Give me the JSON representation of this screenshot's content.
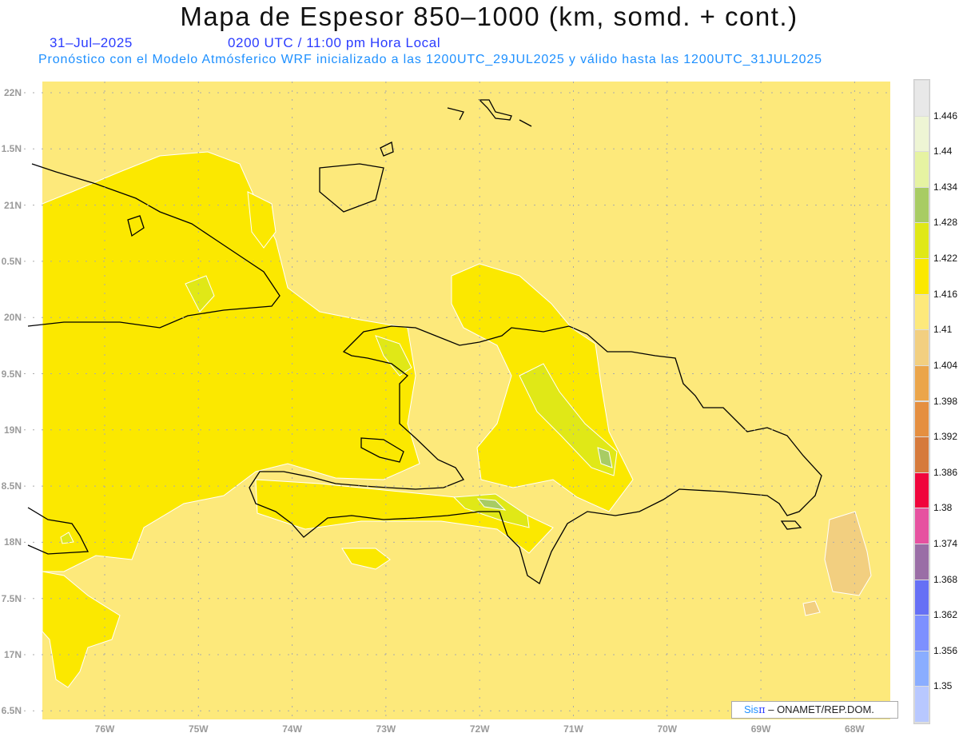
{
  "header": {
    "title": "Mapa de Espesor 850–1000 (km, somd. + cont.)",
    "date": "31–Jul–2025",
    "time": "0200 UTC / 11:00 pm Hora Local",
    "subtitle": "Pronóstico con el Modelo Atmósferico WRF inicializado a las 1200UTC_29JUL2025 y válido hasta las  1200UTC_31JUL2025"
  },
  "axes": {
    "lat_ticks": [
      {
        "value": 22,
        "label": "22N"
      },
      {
        "value": 21.5,
        "label": "1.5N"
      },
      {
        "value": 21,
        "label": "21N"
      },
      {
        "value": 20.5,
        "label": "0.5N"
      },
      {
        "value": 20,
        "label": "20N"
      },
      {
        "value": 19.5,
        "label": "9.5N"
      },
      {
        "value": 19,
        "label": "19N"
      },
      {
        "value": 18.5,
        "label": "8.5N"
      },
      {
        "value": 18,
        "label": "18N"
      },
      {
        "value": 17.5,
        "label": "7.5N"
      },
      {
        "value": 17,
        "label": "17N"
      },
      {
        "value": 16.5,
        "label": "6.5N"
      }
    ],
    "lon_ticks": [
      {
        "value": -76,
        "label": "76W"
      },
      {
        "value": -75,
        "label": "75W"
      },
      {
        "value": -74,
        "label": "74W"
      },
      {
        "value": -73,
        "label": "73W"
      },
      {
        "value": -72,
        "label": "72W"
      },
      {
        "value": -71,
        "label": "71W"
      },
      {
        "value": -70,
        "label": "70W"
      },
      {
        "value": -69,
        "label": "69W"
      },
      {
        "value": -68,
        "label": "68W"
      }
    ]
  },
  "colorbar": {
    "labels": [
      "1.446",
      "1.44",
      "1.434",
      "1.428",
      "1.422",
      "1.416",
      "1.41",
      "1.404",
      "1.398",
      "1.392",
      "1.386",
      "1.38",
      "1.374",
      "1.368",
      "1.362",
      "1.356",
      "1.35"
    ],
    "colors": [
      "#e8e8e8",
      "#eef5d4",
      "#e6f3a2",
      "#a8cc64",
      "#e0e817",
      "#fbe800",
      "#fde97b",
      "#f2cf80",
      "#eba54a",
      "#e58f40",
      "#d67a3c",
      "#f0053c",
      "#e652a0",
      "#9a6ea6",
      "#6670f5",
      "#7d90ff",
      "#8aadff",
      "#b8c8ff"
    ]
  },
  "map_colors": {
    "background": "#fde97b",
    "yellow": "#fbe800",
    "yellow_green": "#e0e817",
    "green": "#a8cc64",
    "tan": "#f2cf80",
    "coast": "#000000"
  },
  "credit": {
    "sis": "Sis",
    "pi": "π",
    "rest": " –  ONAMET/REP.DOM."
  }
}
